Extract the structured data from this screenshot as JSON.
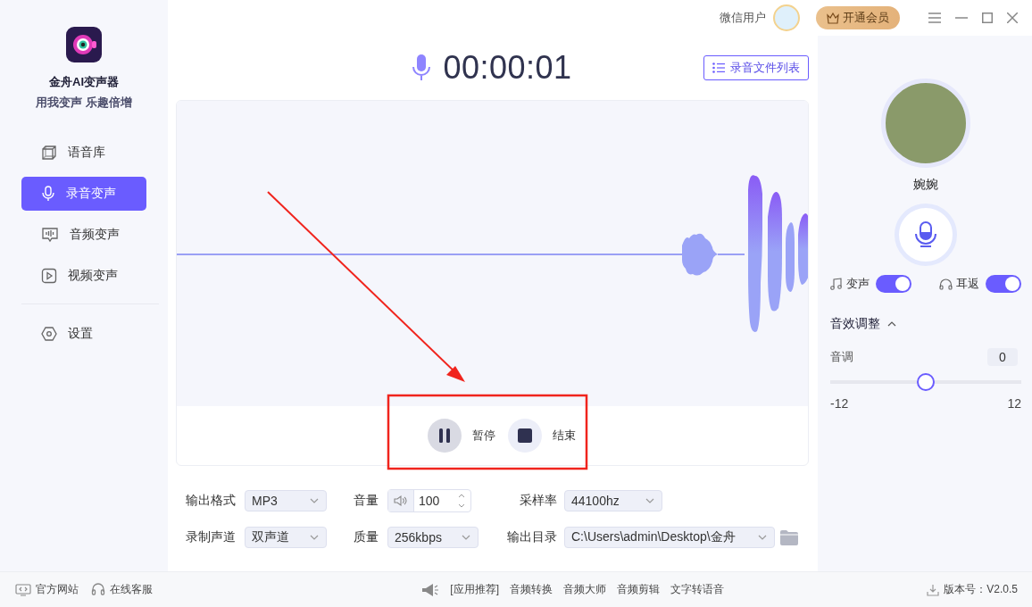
{
  "app": {
    "name": "金舟AI变声器",
    "slogan": "用我变声 乐趣倍增"
  },
  "nav": [
    {
      "label": "语音库",
      "selected": false
    },
    {
      "label": "录音变声",
      "selected": true
    },
    {
      "label": "音频变声",
      "selected": false
    },
    {
      "label": "视频变声",
      "selected": false
    }
  ],
  "nav_bottom": [
    {
      "label": "设置",
      "selected": false
    }
  ],
  "header": {
    "user": "微信用户",
    "vip_button": "开通会员"
  },
  "recorder": {
    "time": "00:00:01",
    "file_list_button": "录音文件列表",
    "pause": "暂停",
    "stop": "结束"
  },
  "fields": [
    {
      "label": "输出格式",
      "kind": "select",
      "value": "MP3"
    },
    {
      "label": "音量",
      "kind": "volume",
      "value": "100"
    },
    {
      "label": "采样率",
      "kind": "select",
      "value": "44100hz"
    },
    {
      "label": "录制声道",
      "kind": "select",
      "value": "双声道"
    },
    {
      "label": "质量",
      "kind": "select",
      "value": "256kbps"
    },
    {
      "label": "输出目录",
      "kind": "path",
      "value": "C:\\Users\\admin\\Desktop\\金舟"
    }
  ],
  "voice": {
    "name": "婉婉"
  },
  "toggles": [
    {
      "label": "变声",
      "on": true
    },
    {
      "label": "耳返",
      "on": true
    }
  ],
  "effects": {
    "title": "音效调整",
    "expanded": true,
    "pitch": {
      "label": "音调",
      "value": "0",
      "level": 0.5,
      "min": "-12",
      "max": "12"
    }
  },
  "footer": {
    "links": [
      "官方网站",
      "在线客服"
    ],
    "promo_label": "[应用推荐]",
    "apps": [
      "音频转换",
      "音频大师",
      "音频剪辑",
      "文字转语音"
    ],
    "version": "版本号：V2.0.5"
  }
}
